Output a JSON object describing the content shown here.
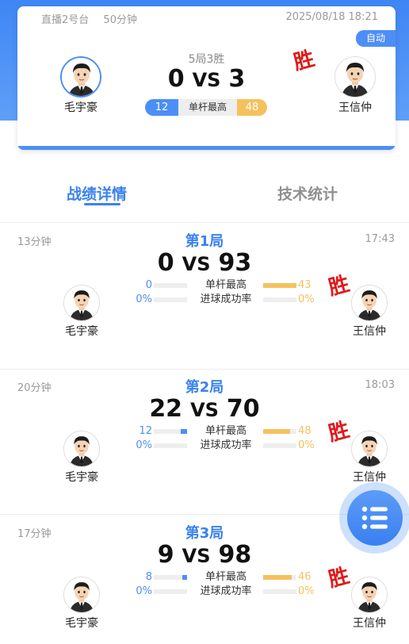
{
  "header": {
    "table": "直播2号台",
    "duration": "50分钟",
    "datetime": "2025/08/18 18:21",
    "mode": "自动",
    "format": "5局3胜",
    "score_left": "0",
    "vs": "VS",
    "score_right": "3",
    "best_break_label": "单杆最高",
    "best_break_left": "12",
    "best_break_right": "48",
    "player_left": "毛宇豪",
    "player_right": "王信仲",
    "win_label": "胜"
  },
  "tabs": {
    "active": "战绩详情",
    "inactive": "技术统计"
  },
  "games": [
    {
      "title": "第1局",
      "duration": "13分钟",
      "time": "17:43",
      "score_left": "0",
      "score_right": "93",
      "best_left": "0",
      "best_right": "43",
      "best_left_fraction": 0,
      "best_right_fraction": 1,
      "rate_left": "0%",
      "rate_right": "0%",
      "best_label": "单杆最高",
      "rate_label": "进球成功率",
      "player_left": "毛宇豪",
      "player_right": "王信仲",
      "win_label": "胜"
    },
    {
      "title": "第2局",
      "duration": "20分钟",
      "time": "18:03",
      "score_left": "22",
      "score_right": "70",
      "best_left": "12",
      "best_right": "48",
      "best_left_fraction": 0.2,
      "best_right_fraction": 0.8,
      "rate_left": "0%",
      "rate_right": "0%",
      "best_label": "单杆最高",
      "rate_label": "进球成功率",
      "player_left": "毛宇豪",
      "player_right": "王信仲",
      "win_label": "胜"
    },
    {
      "title": "第3局",
      "duration": "17分钟",
      "time": "",
      "score_left": "9",
      "score_right": "98",
      "best_left": "8",
      "best_right": "46",
      "best_left_fraction": 0.15,
      "best_right_fraction": 0.85,
      "rate_left": "0%",
      "rate_right": "0%",
      "best_label": "单杆最高",
      "rate_label": "进球成功率",
      "player_left": "毛宇豪",
      "player_right": "王信仲",
      "win_label": "胜"
    }
  ],
  "fab": {
    "icon": "list-menu-icon"
  },
  "colors": {
    "accent": "#3a82f0",
    "left_player": "#4d8ef6",
    "right_player": "#f5c15f",
    "win": "#e01a1a"
  }
}
